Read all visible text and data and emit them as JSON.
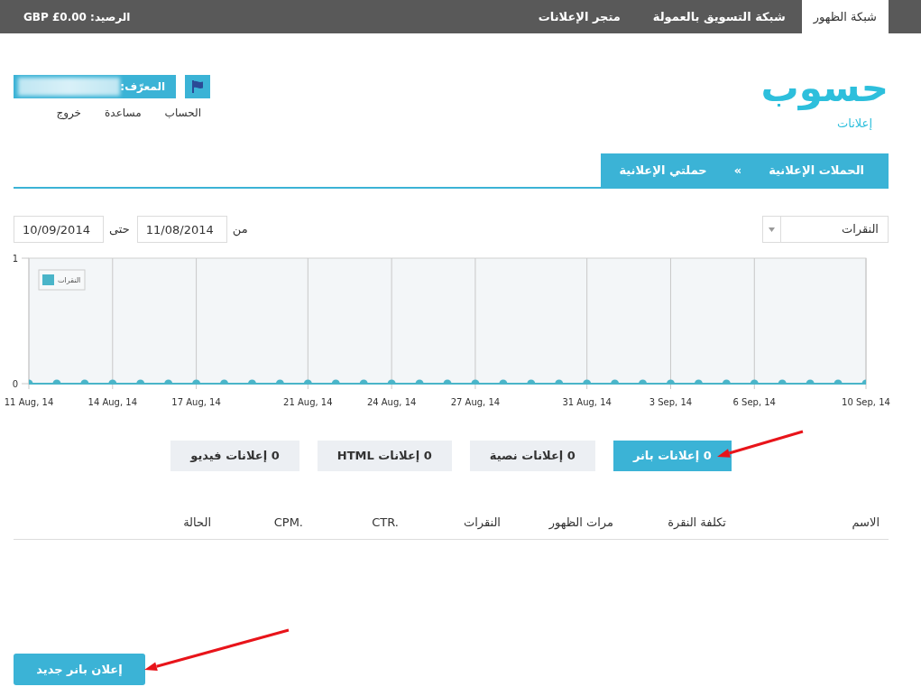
{
  "top_bar": {
    "tabs": [
      {
        "label": "شبكة الظهور",
        "selected": true
      },
      {
        "label": "شبكة التسويق بالعمولة",
        "selected": false
      },
      {
        "label": "متجر الإعلانات",
        "selected": false
      }
    ],
    "balance": "الرصيد: GBP £0.00"
  },
  "logo": {
    "wordmark": "حسوب",
    "subtitle": "إعلانات"
  },
  "account": {
    "id_label": "المعرّف:",
    "links": [
      "الحساب",
      "مساعدة",
      "خروج"
    ]
  },
  "breadcrumb": {
    "items": [
      "الحملات الإعلانية",
      "حملتي الإعلانية"
    ],
    "separator": "»"
  },
  "filters": {
    "metric": "النقرات",
    "from_label": "من",
    "from_date": "11/08/2014",
    "to_label": "حتى",
    "to_date": "10/09/2014"
  },
  "chart": {
    "chart_data": {
      "type": "line",
      "categories": [
        "11 Aug, 14",
        null,
        null,
        "14 Aug, 14",
        null,
        null,
        "17 Aug, 14",
        null,
        null,
        null,
        "21 Aug, 14",
        null,
        null,
        "24 Aug, 14",
        null,
        null,
        "27 Aug, 14",
        null,
        null,
        null,
        "31 Aug, 14",
        null,
        null,
        "3 Sep, 14",
        null,
        null,
        "6 Sep, 14",
        null,
        null,
        null,
        "10 Sep, 14"
      ],
      "ylim": [
        0,
        1
      ],
      "yticks": [
        0,
        1
      ],
      "grid": true,
      "series": [
        {
          "name": "النقرات",
          "color": "#4ab5c9",
          "values": [
            0,
            0,
            0,
            0,
            0,
            0,
            0,
            0,
            0,
            0,
            0,
            0,
            0,
            0,
            0,
            0,
            0,
            0,
            0,
            0,
            0,
            0,
            0,
            0,
            0,
            0,
            0,
            0,
            0,
            0,
            0
          ]
        }
      ]
    }
  },
  "ad_types": [
    {
      "label": "0 إعلانات بانر",
      "selected": true
    },
    {
      "label": "0 إعلانات نصية",
      "selected": false
    },
    {
      "label": "0 إعلانات HTML",
      "selected": false
    },
    {
      "label": "0 إعلانات فيديو",
      "selected": false
    }
  ],
  "table": {
    "columns": [
      "الاسم",
      "تكلفة النقرة",
      "مرات الظهور",
      "النقرات",
      "CTR.",
      "CPM.",
      "الحالة"
    ]
  },
  "new_button": "إعلان بانر جديد"
}
